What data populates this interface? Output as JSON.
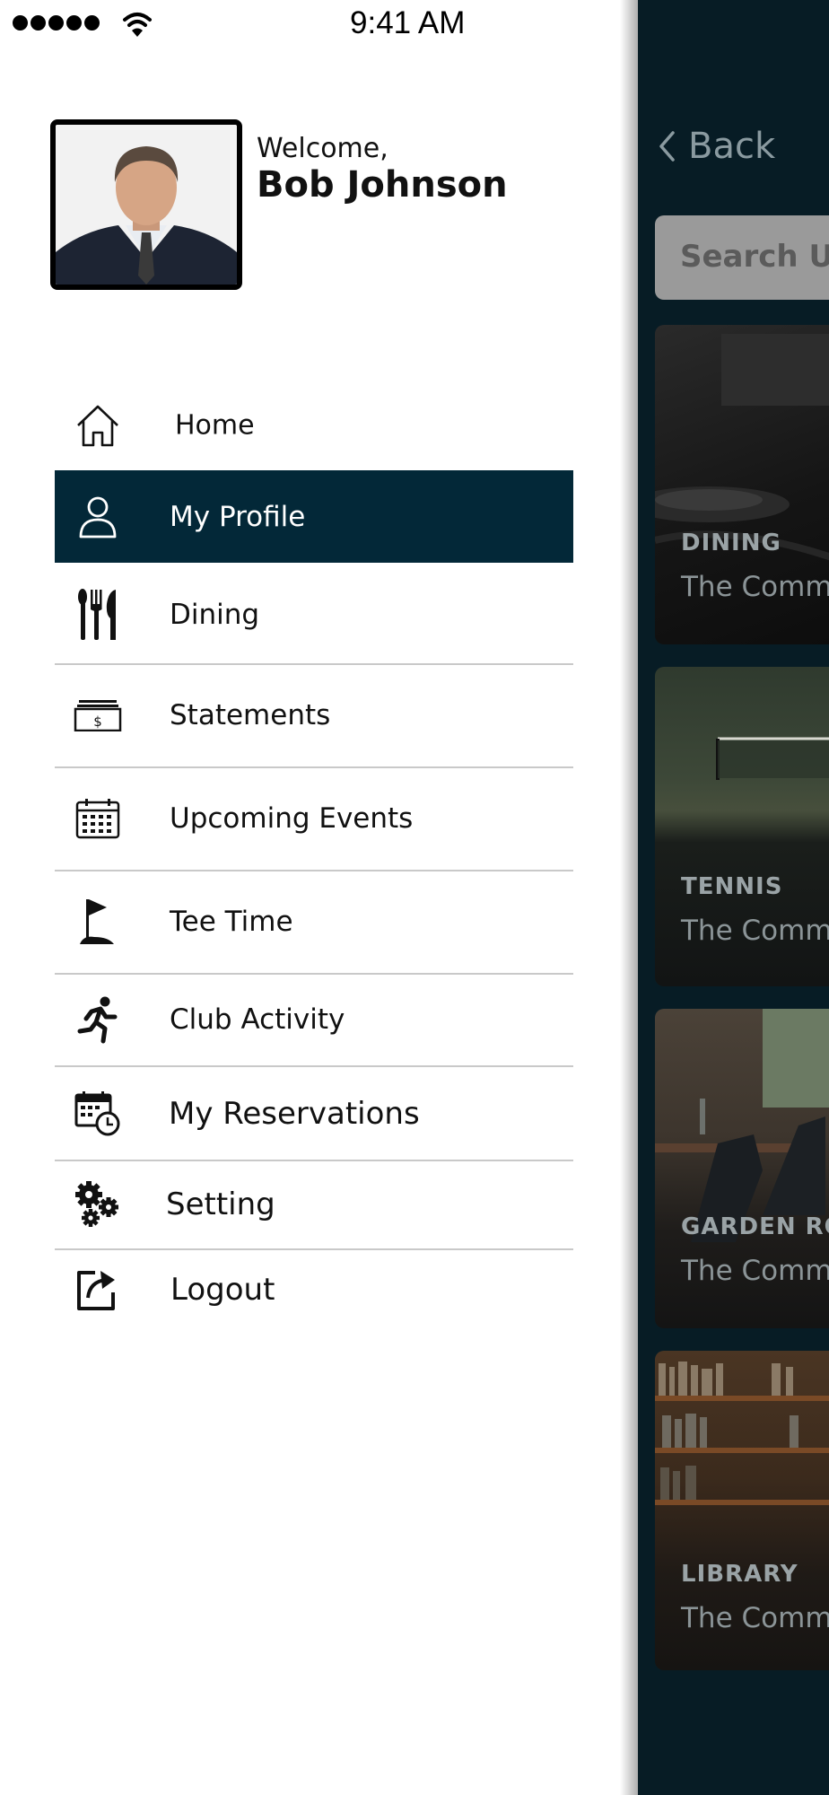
{
  "status_bar": {
    "time": "9:41 AM"
  },
  "profile": {
    "welcome": "Welcome,",
    "name": "Bob Johnson"
  },
  "menu": [
    {
      "label": "Home",
      "icon": "home-icon",
      "active": false
    },
    {
      "label": "My Profile",
      "icon": "user-icon",
      "active": true
    },
    {
      "label": "Dining",
      "icon": "fork-knife-icon",
      "active": false
    },
    {
      "label": "Statements",
      "icon": "bill-icon",
      "active": false
    },
    {
      "label": "Upcoming Events",
      "icon": "calendar-icon",
      "active": false
    },
    {
      "label": "Tee Time",
      "icon": "golf-flag-icon",
      "active": false
    },
    {
      "label": "Club Activity",
      "icon": "runner-icon",
      "active": false
    },
    {
      "label": "My Reservations",
      "icon": "calendar-clock-icon",
      "active": false
    },
    {
      "label": "Setting",
      "icon": "gears-icon",
      "active": false
    },
    {
      "label": "Logout",
      "icon": "logout-icon",
      "active": false
    }
  ],
  "panel": {
    "back_label": "Back",
    "search_placeholder": "Search Up",
    "cards": [
      {
        "category": "DINING",
        "subtitle": "The Comm"
      },
      {
        "category": "TENNIS",
        "subtitle": "The Comm"
      },
      {
        "category": "GARDEN RO",
        "subtitle": "The Comm"
      },
      {
        "category": "LIBRARY",
        "subtitle": "The Comm"
      }
    ]
  },
  "colors": {
    "active_menu_bg": "#032838",
    "panel_bg": "#071c25",
    "divider": "#c9c9c9"
  }
}
